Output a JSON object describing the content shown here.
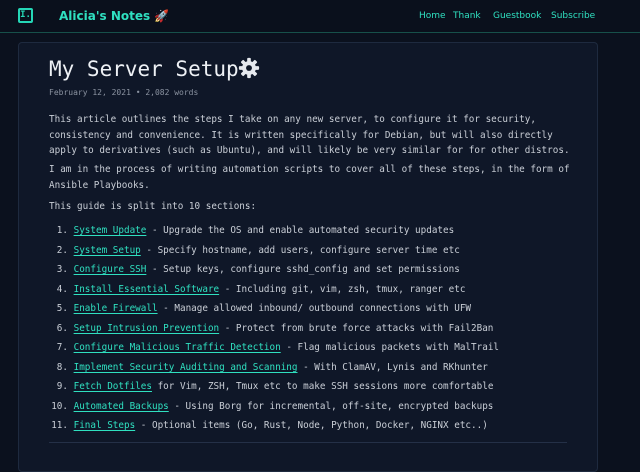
{
  "header": {
    "logo_glyph": "I.",
    "site_title": "Alicia's Notes 🚀",
    "nav": [
      "Home",
      "Thank",
      "Guestbook",
      "Subscribe"
    ]
  },
  "article": {
    "title": "My Server Setup",
    "title_icon": "gear-icon",
    "meta": "February 12, 2021 • 2,082 words",
    "paragraphs": [
      "This article outlines the steps I take on any new server, to configure it for security, consistency and convenience. It is written specifically for Debian, but will also directly apply to derivatives (such as Ubuntu), and will likely be very similar for for other distros.",
      "I am in the process of writing automation scripts to cover all of these steps, in the form of Ansible Playbooks.",
      "This guide is split into 10 sections:"
    ],
    "sections": [
      {
        "num": "1.",
        "link": "System Update",
        "desc": " - Upgrade the OS and enable automated security updates"
      },
      {
        "num": "2.",
        "link": "System Setup",
        "desc": " - Specify hostname, add users, configure server time etc"
      },
      {
        "num": "3.",
        "link": "Configure SSH",
        "desc": " - Setup keys, configure sshd_config and set permissions"
      },
      {
        "num": "4.",
        "link": "Install Essential Software",
        "desc": " - Including git, vim, zsh, tmux, ranger etc"
      },
      {
        "num": "5.",
        "link": "Enable Firewall",
        "desc": " - Manage allowed inbound/ outbound connections with UFW"
      },
      {
        "num": "6.",
        "link": "Setup Intrusion Prevention",
        "desc": " - Protect from brute force attacks with Fail2Ban"
      },
      {
        "num": "7.",
        "link": "Configure Malicious Traffic Detection",
        "desc": " - Flag malicious packets with MalTrail"
      },
      {
        "num": "8.",
        "link": "Implement Security Auditing and Scanning",
        "desc": " - With ClamAV, Lynis and RKhunter"
      },
      {
        "num": "9.",
        "link": "Fetch Dotfiles",
        "desc": " for Vim, ZSH, Tmux etc to make SSH sessions more comfortable"
      },
      {
        "num": "10.",
        "link": "Automated Backups",
        "desc": " - Using Borg for incremental, off-site, encrypted backups"
      },
      {
        "num": "11.",
        "link": "Final Steps",
        "desc": " - Optional items (Go, Rust, Node, Python, Docker, NGINX etc..)"
      }
    ]
  },
  "colors": {
    "accent": "#2fe0c0",
    "background": "#0b111e",
    "card": "#0f1728"
  }
}
